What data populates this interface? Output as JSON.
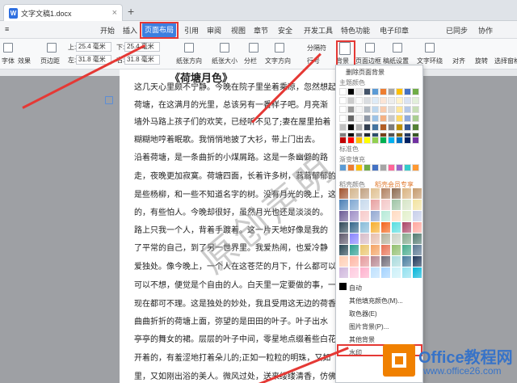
{
  "window": {
    "doc_tab": "文字文稿1.docx",
    "new_tab_symbol": "+",
    "close_symbol": "×"
  },
  "menu": {
    "items": [
      "开始",
      "插入",
      "页面布局",
      "引用",
      "审阅",
      "视图",
      "章节",
      "安全",
      "开发工具",
      "特色功能",
      "电子印章"
    ],
    "active": "页面布局",
    "right": {
      "unsynced": "已同步",
      "collab": "协作",
      "share": "分享"
    }
  },
  "toolbar": {
    "left_labels": [
      "主题",
      "字体",
      "效果",
      "页边距"
    ],
    "margins": {
      "top_label": "上:",
      "top": "25.4 毫米",
      "bottom_label": "下:",
      "bottom": "25.4 毫米",
      "left_label": "左:",
      "left": "31.8 毫米",
      "right_label": "右:",
      "right": "31.8 毫米"
    },
    "row1": [
      "分栏",
      "分隔符",
      "背景",
      "页面边框",
      "稿纸设置",
      "文字环绕",
      "对齐",
      "旋转",
      "选择窗格"
    ],
    "row2": [
      "纸张方向",
      "纸张大小",
      "分栏",
      "文字方向",
      "行号",
      "背景",
      "页面边框",
      "稿纸设置",
      "文字环绕",
      "对齐",
      "旋转",
      "选择窗格"
    ]
  },
  "document": {
    "lines": [
      "这几天心里颇不宁静。今晚在院子里坐着乘凉，忽然想起",
      "荷塘，在这满月的光里，总该另有一番样子吧。月亮渐",
      "墙外马路上孩子们的欢笑，已经听不见了;妻在屋里拍着",
      "糊糊地哼着眠歌。我悄悄地披了大衫，带上门出去。",
      "沿着荷塘，是一条曲折的小煤屑路。这是一条幽僻的路",
      "走，夜晚更加寂寞。荷塘四面，长着许多树，蓊蓊郁郁的",
      "是些杨柳，和一些不知道名字的树。没有月光的晚上，这",
      "的，有些怕人。今晚却很好，虽然月光也还是淡淡的。",
      "路上只我一个人，背着手踱着。这一片天地好像是我的",
      "了平常的自己，到了另一世界里。我爱热闹，也爱冷静",
      "爱独处。像今晚上，一个人在这苍茫的月下，什么都可以",
      "可以不想，便觉是个自由的人。白天里一定要做的事，一",
      "现在都可不理。这是独处的妙处，我且受用这无边的荷香",
      "曲曲折折的荷塘上面，弥望的是田田的叶子。叶子出水",
      "亭亭的舞女的裙。层层的叶子中间，零星地点缀着些白花",
      "开着的，有羞涩地打着朵儿的;正如一粒粒的明珠，又如",
      "里，又如刚出浴的美人。微风过处，送来缕缕清香，仿佛远处高楼上"
    ],
    "heading_partial": "《荷塘月色》",
    "watermark": "原创声明"
  },
  "background_menu": {
    "remove_bg": "删除页面背景",
    "theme_colors": "主题颜色",
    "standard_colors": "标准色",
    "gradient_fill": "渐变填充",
    "texture_fill": "稻壳颜色",
    "vip_exclusive": "稻壳会员专享",
    "auto": "自动",
    "other_fill_color": "其他填充颜色(M)...",
    "eyedropper": "取色器(E)",
    "picture_bg": "图片背景(P)...",
    "other_bg": "其他背景",
    "watermark": "水印"
  },
  "swatches": {
    "theme_row1": [
      "#ffffff",
      "#000000",
      "#e7e6e6",
      "#44546a",
      "#5b9bd5",
      "#ed7d31",
      "#a5a5a5",
      "#ffc000",
      "#4472c4",
      "#70ad47"
    ],
    "standard": [
      "#c00000",
      "#ff0000",
      "#ffc000",
      "#ffff00",
      "#92d050",
      "#00b050",
      "#00b0f0",
      "#0070c0",
      "#002060",
      "#7030a0"
    ],
    "gradient": [
      "#5b9bd5",
      "#ed7d31",
      "#ffc000",
      "#70ad47",
      "#4472c4",
      "#a5a5a5",
      "#ff6699",
      "#9966cc",
      "#33cccc",
      "#ff9933"
    ],
    "texture_rows": [
      [
        "#a0522d",
        "#d2b48c",
        "#c0a080",
        "#e0c090",
        "#b08060",
        "#8c6a4f",
        "#d9b380",
        "#c49a6c"
      ],
      [
        "#4a7fb5",
        "#7fa7d1",
        "#c6d9ec",
        "#e7a0a0",
        "#f4c7c7",
        "#9ec4a5",
        "#d6e5c6",
        "#f2e3a0"
      ],
      [
        "#6b5b95",
        "#9f8fc6",
        "#f7cac9",
        "#92a8d1",
        "#b5ead7",
        "#ffdac1",
        "#e2f0cb",
        "#c7ceea"
      ],
      [
        "#2f4858",
        "#33658a",
        "#86bbd8",
        "#f6ae2d",
        "#f26419",
        "#55dde0",
        "#aa4465",
        "#ffa69e"
      ],
      [
        "#5d576b",
        "#8884ff",
        "#d7bcc8",
        "#e6beae",
        "#b2b09b",
        "#cad2c5",
        "#84a98c",
        "#52796f"
      ],
      [
        "#264653",
        "#2a9d8f",
        "#e9c46a",
        "#f4a261",
        "#e76f51",
        "#90be6d",
        "#43aa8b",
        "#577590"
      ],
      [
        "#ffcdb2",
        "#ffb4a2",
        "#e5989b",
        "#b5838d",
        "#6d6875",
        "#a8dadc",
        "#457b9d",
        "#1d3557"
      ],
      [
        "#cdb4db",
        "#ffc8dd",
        "#ffafcc",
        "#bde0fe",
        "#a2d2ff",
        "#caf0f8",
        "#90e0ef",
        "#00b4d8"
      ]
    ]
  },
  "brand": {
    "name": "Office教程网",
    "url": "www.office26.com"
  }
}
